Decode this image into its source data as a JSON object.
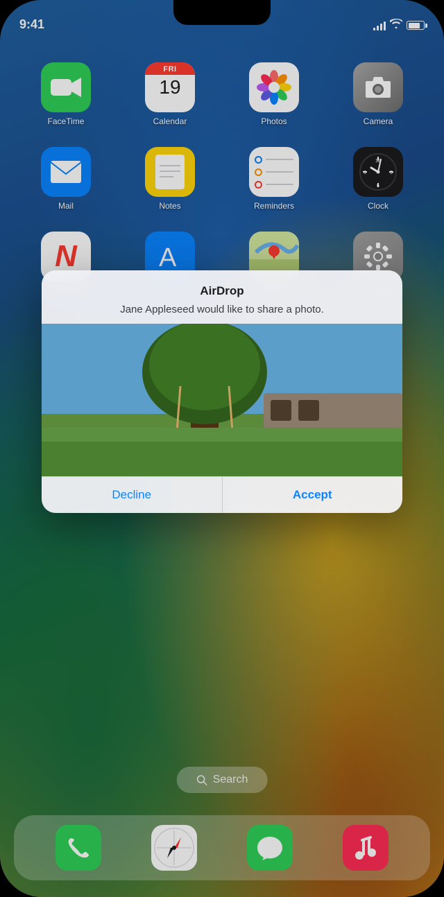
{
  "status_bar": {
    "time": "9:41",
    "signal_bars": 4,
    "battery_pct": 80
  },
  "home_screen": {
    "apps_row1": [
      {
        "id": "facetime",
        "label": "FaceTime",
        "icon_type": "facetime"
      },
      {
        "id": "calendar",
        "label": "Calendar",
        "icon_type": "calendar",
        "day_of_week": "FRI",
        "date": "19"
      },
      {
        "id": "photos",
        "label": "Photos",
        "icon_type": "photos"
      },
      {
        "id": "camera",
        "label": "Camera",
        "icon_type": "camera"
      }
    ],
    "apps_row2": [
      {
        "id": "mail",
        "label": "Mail",
        "icon_type": "mail"
      },
      {
        "id": "notes",
        "label": "Notes",
        "icon_type": "notes"
      },
      {
        "id": "reminders",
        "label": "Reminders",
        "icon_type": "reminders"
      },
      {
        "id": "clock",
        "label": "Clock",
        "icon_type": "clock"
      }
    ],
    "apps_row3": [
      {
        "id": "news",
        "label": "News",
        "icon_type": "news"
      },
      {
        "id": "appstore",
        "label": "App Store",
        "icon_type": "appstore"
      },
      {
        "id": "maps",
        "label": "Maps",
        "icon_type": "maps"
      },
      {
        "id": "settings",
        "label": "Settings",
        "icon_type": "settings"
      }
    ]
  },
  "airdrop_modal": {
    "title": "AirDrop",
    "subtitle": "Jane Appleseed would like to share a photo.",
    "decline_label": "Decline",
    "accept_label": "Accept"
  },
  "search": {
    "label": "Search"
  },
  "dock": {
    "apps": [
      {
        "id": "phone",
        "label": "Phone",
        "icon_type": "phone"
      },
      {
        "id": "safari",
        "label": "Safari",
        "icon_type": "safari"
      },
      {
        "id": "messages",
        "label": "Messages",
        "icon_type": "messages"
      },
      {
        "id": "music",
        "label": "Music",
        "icon_type": "music"
      }
    ]
  }
}
